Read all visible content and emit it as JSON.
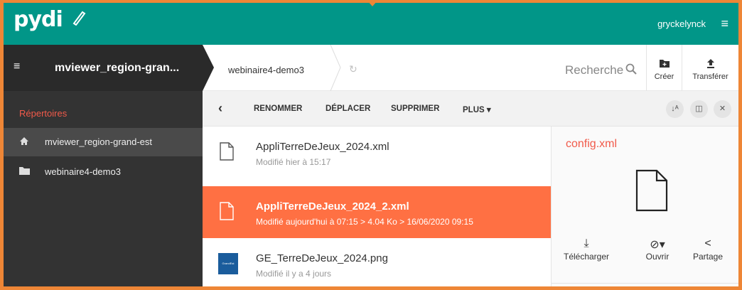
{
  "app": {
    "logo": "pydi",
    "user": "gryckelynck"
  },
  "workspace": {
    "title": "mviewer_region-gran..."
  },
  "breadcrumb": {
    "current": "webinaire4-demo3"
  },
  "search": {
    "label": "Recherche"
  },
  "toolbar": {
    "create_label": "Créer",
    "upload_label": "Transférer"
  },
  "sidebar": {
    "title": "Répertoires",
    "items": [
      {
        "label": "mviewer_region-grand-est",
        "icon": "home-icon",
        "active": true
      },
      {
        "label": "webinaire4-demo3",
        "icon": "folder-icon",
        "active": false
      }
    ]
  },
  "actions": {
    "rename": "RENOMMER",
    "move": "DÉPLACER",
    "delete": "SUPPRIMER",
    "more": "PLUS ▾"
  },
  "files": [
    {
      "name": "AppliTerreDeJeux_2024.xml",
      "meta": "Modifié hier à 15:17",
      "selected": false,
      "icon": "file-icon"
    },
    {
      "name": "AppliTerreDeJeux_2024_2.xml",
      "meta": "Modifié aujourd'hui à 07:15 > 4.04 Ko > 16/06/2020 09:15",
      "selected": true,
      "icon": "file-icon"
    },
    {
      "name": "GE_TerreDeJeux_2024.png",
      "meta": "Modifié il y a 4 jours",
      "selected": false,
      "icon": "image-thumbnail"
    }
  ],
  "detail": {
    "title": "config.xml",
    "download": "Télécharger",
    "open": "Ouvrir",
    "share": "Partage"
  },
  "colors": {
    "topbar": "#019688",
    "frame": "#ee8636",
    "selected": "#ff7043",
    "accent": "#f15a4a"
  }
}
